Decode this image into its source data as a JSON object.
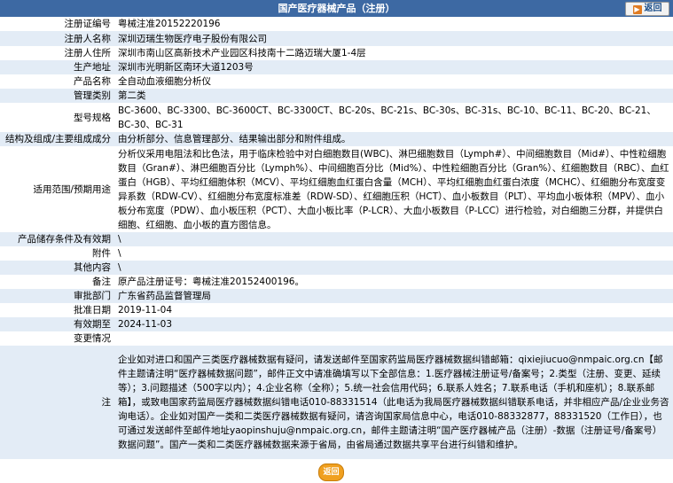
{
  "header": {
    "title": "国产医疗器械产品（注册）",
    "back_label": "返回"
  },
  "rows": [
    {
      "label": "注册证编号",
      "value": "粤械注准20152220196"
    },
    {
      "label": "注册人名称",
      "value": "深圳迈瑞生物医疗电子股份有限公司"
    },
    {
      "label": "注册人住所",
      "value": "深圳市南山区高新技术产业园区科技南十二路迈瑞大厦1-4层"
    },
    {
      "label": "生产地址",
      "value": "深圳市光明新区南环大道1203号"
    },
    {
      "label": "产品名称",
      "value": "全自动血液细胞分析仪"
    },
    {
      "label": "管理类别",
      "value": "第二类"
    },
    {
      "label": "型号规格",
      "value": "BC-3600、BC-3300、BC-3600CT、BC-3300CT、BC-20s、BC-21s、BC-30s、BC-31s、BC-10、BC-11、BC-20、BC-21、BC-30、BC-31"
    },
    {
      "label": "结构及组成/主要组成成分",
      "value": "由分析部分、信息管理部分、结果输出部分和附件组成。"
    },
    {
      "label": "适用范围/预期用途",
      "value": "分析仪采用电阻法和比色法，用于临床检验中对白细胞数目(WBC)、淋巴细胞数目（Lymph#）、中间细胞数目（Mid#）、中性粒细胞数目（Gran#）、淋巴细胞百分比（Lymph%）、中间细胞百分比（Mid%）、中性粒细胞百分比（Gran%）、红细胞数目（RBC）、血红蛋白（HGB）、平均红细胞体积（MCV）、平均红细胞血红蛋白含量（MCH）、平均红细胞血红蛋白浓度（MCHC）、红细胞分布宽度变异系数（RDW-CV）、红细胞分布宽度标准差（RDW-SD）、红细胞压积（HCT）、血小板数目（PLT）、平均血小板体积（MPV）、血小板分布宽度（PDW）、血小板压积（PCT）、大血小板比率（P-LCR）、大血小板数目（P-LCC）进行检验，对白细胞三分群，并提供白细胞、红细胞、血小板的直方图信息。"
    },
    {
      "label": "产品储存条件及有效期",
      "value": "\\"
    },
    {
      "label": "附件",
      "value": "\\"
    },
    {
      "label": "其他内容",
      "value": "\\"
    },
    {
      "label": "备注",
      "value": "原产品注册证号：粤械注准20152400196。"
    },
    {
      "label": "审批部门",
      "value": "广东省药品监督管理局"
    },
    {
      "label": "批准日期",
      "value": "2019-11-04"
    },
    {
      "label": "有效期至",
      "value": "2024-11-03"
    },
    {
      "label": "变更情况",
      "value": ""
    },
    {
      "label": "注",
      "value": "企业如对进口和国产三类医疗器械数据有疑问，请发送邮件至国家药监局医疗器械数据纠错邮箱：qixiejiucuo@nmpaic.org.cn【邮件主题请注明“医疗器械数据问题”，邮件正文中请准确填写以下全部信息：1.医疗器械注册证号/备案号；2.类型（注册、变更、延续等）；3.问题描述（500字以内）；4.企业名称（全称）；5.统一社会信用代码；6.联系人姓名；7.联系电话（手机和座机）；8.联系邮箱】，或致电国家药监局医疗器械数据纠错电话010-88331514（此电话为我局医疗器械数据纠错联系电话，并非相应产品/企业业务咨询电话）。企业如对国产一类和二类医疗器械数据有疑问，请咨询国家局信息中心，电话010-88332877，88331520（工作日），也可通过发送邮件至邮件地址yaopinshuju@nmpaic.org.cn，邮件主题请注明“国产医疗器械产品（注册）-数据（注册证号/备案号）数据问题”。国产一类和二类医疗器械数据来源于省局，由省局通过数据共享平台进行纠错和维护。"
    }
  ],
  "footer": {
    "back_label": "返回"
  }
}
